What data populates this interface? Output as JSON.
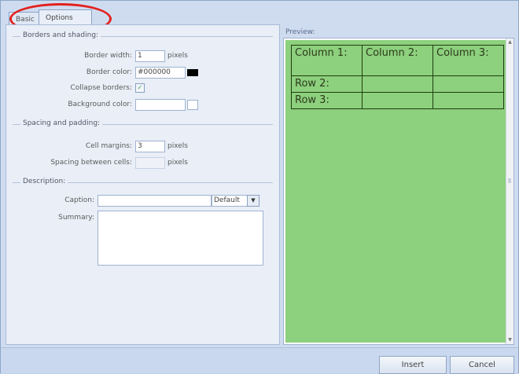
{
  "tabs": {
    "basic": "Basic",
    "options": "Options"
  },
  "border_shading": {
    "label": "Borders and shading:",
    "border_width": {
      "label": "Border width:",
      "value": "1",
      "unit": "pixels"
    },
    "border_color": {
      "label": "Border color:",
      "value": "#000000"
    },
    "collapse_borders": {
      "label": "Collapse borders:",
      "checked": "✓"
    },
    "background_color": {
      "label": "Background color:",
      "value": ""
    }
  },
  "spacing_padding": {
    "label": "Spacing and padding:",
    "cell_margins": {
      "label": "Cell margins:",
      "value": "3",
      "unit": "pixels"
    },
    "spacing_between_cells": {
      "label": "Spacing between cells:",
      "value": "",
      "unit": "pixels"
    }
  },
  "description": {
    "label": "Description:",
    "caption": {
      "label": "Caption:",
      "value": "",
      "select_value": "Default"
    },
    "summary": {
      "label": "Summary:",
      "value": ""
    }
  },
  "preview": {
    "label": "Preview:",
    "rows": [
      [
        "Column 1:",
        "Column 2:",
        "Column 3:"
      ],
      [
        "Row 2:",
        "",
        ""
      ],
      [
        "Row 3:",
        "",
        ""
      ]
    ],
    "background": "#8dd07e"
  },
  "buttons": {
    "insert": "Insert",
    "cancel": "Cancel"
  },
  "colors": {
    "highlight_ring": "#e3211e",
    "border_swatch": "#000000"
  }
}
